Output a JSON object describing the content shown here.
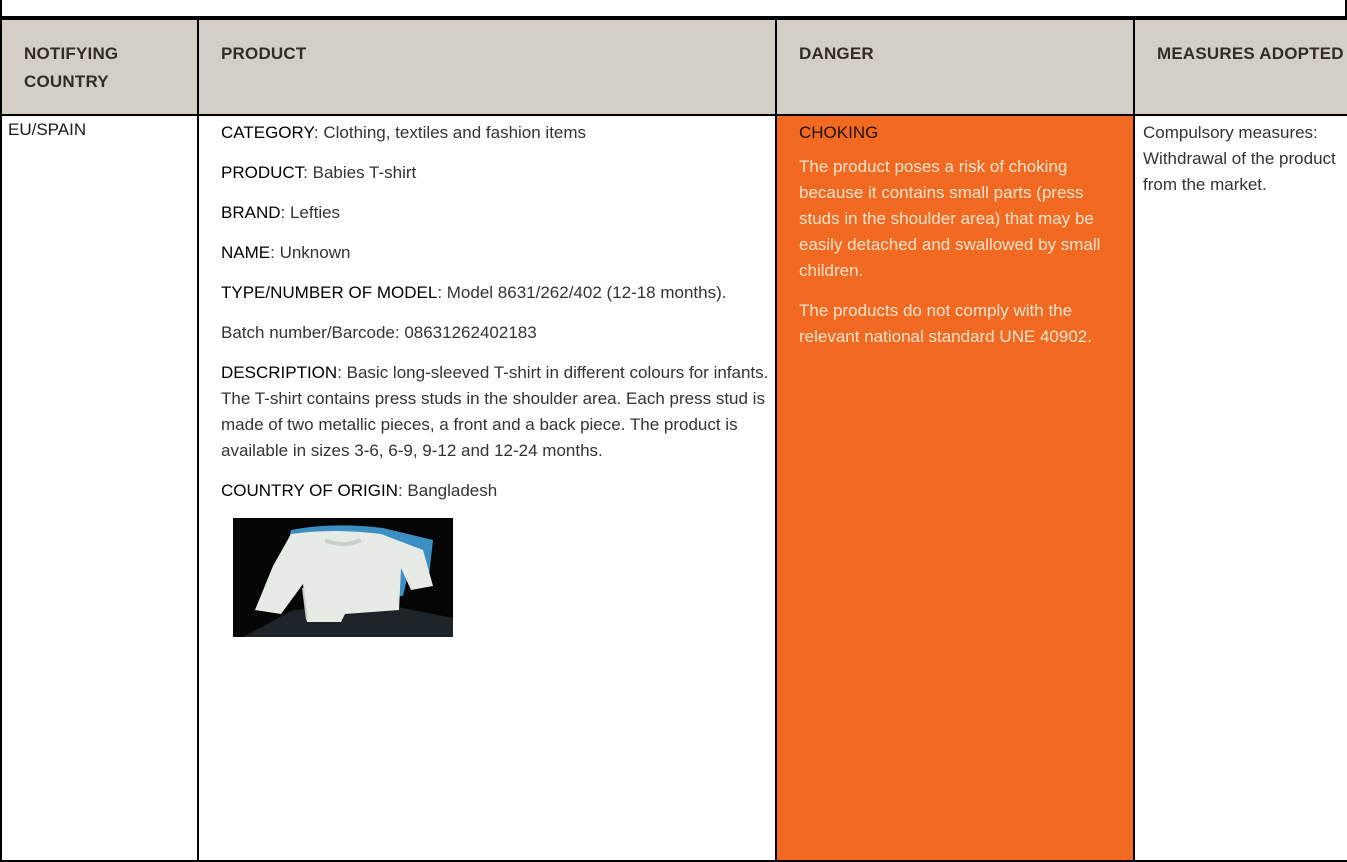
{
  "header": {
    "country": "NOTIFYING COUNTRY",
    "product": "PRODUCT",
    "danger": "DANGER",
    "measures": "MEASURES ADOPTED"
  },
  "row": {
    "country": "EU/SPAIN",
    "product": {
      "category_label": "CATEGORY",
      "category_value": ": Clothing, textiles and fashion items",
      "product_label": "PRODUCT",
      "product_value": ": Babies T-shirt",
      "brand_label": "BRAND",
      "brand_value": ": Lefties",
      "name_label": "NAME",
      "name_value": ": Unknown",
      "model_label": "TYPE/NUMBER OF MODEL",
      "model_value": ": Model 8631/262/402 (12-18 months).",
      "batch": "Batch number/Barcode: 08631262402183",
      "description_label": "DESCRIPTION",
      "description_value": ": Basic long-sleeved T-shirt in different colours for infants. The T-shirt contains press studs in the shoulder area. Each press stud is made of two metallic pieces, a front and a back piece. The product is available in sizes 3-6, 6-9, 9-12 and 12-24 months.",
      "origin_label": "COUNTRY OF ORIGIN",
      "origin_value": ": Bangladesh"
    },
    "danger": {
      "title": "CHOKING",
      "text1": "The product poses a risk of choking because it contains small parts (press studs in the shoulder area) that may be easily detached and swallowed by small children.",
      "text2": "The products do not comply with the relevant national standard UNE 40902."
    },
    "measures": "Compulsory measures: Withdrawal of the product from the market."
  },
  "colors": {
    "header_bg": "#d4cfc6",
    "danger_bg": "#f26a22"
  }
}
